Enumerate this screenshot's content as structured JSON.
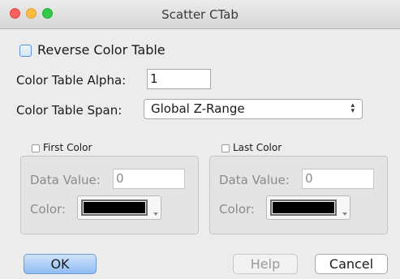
{
  "window": {
    "title": "Scatter CTab"
  },
  "reverse": {
    "label": "Reverse Color Table",
    "checked": false
  },
  "alpha": {
    "label": "Color Table Alpha:",
    "value": "1"
  },
  "span": {
    "label": "Color Table Span:",
    "selected": "Global Z-Range",
    "arrows": "▴▾"
  },
  "first_color": {
    "legend": "First Color",
    "checked": false,
    "data_value_label": "Data Value:",
    "data_value": "0",
    "color_label": "Color:",
    "color": "#000000"
  },
  "last_color": {
    "legend": "Last Color",
    "checked": false,
    "data_value_label": "Data Value:",
    "data_value": "0",
    "color_label": "Color:",
    "color": "#000000"
  },
  "buttons": {
    "ok": "OK",
    "help": "Help",
    "cancel": "Cancel"
  }
}
